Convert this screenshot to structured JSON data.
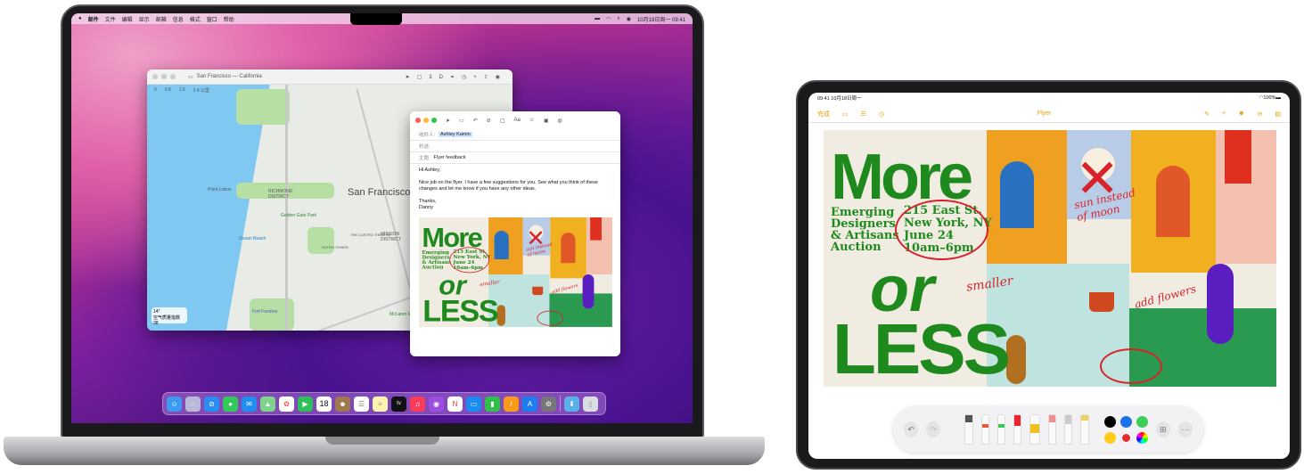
{
  "mac": {
    "menubar": {
      "items": [
        "邮件",
        "文件",
        "编辑",
        "显示",
        "邮箱",
        "信息",
        "格式",
        "窗口",
        "帮助"
      ],
      "clock": "10月18日周一 09:41"
    },
    "maps": {
      "title": "San Francisco — California",
      "scale": [
        "0",
        "0.8",
        "1.6",
        "2.4 公里"
      ],
      "labels": {
        "city": "San Francisco",
        "richmond": "RICHMOND DISTRICT",
        "mission": "MISSION DISTRICT",
        "point_lobos": "Point Lobos",
        "ggpark": "Golden Gate Park",
        "ocean_beach": "Ocean Beach",
        "fort_funston": "Fort Funston",
        "mclaren": "McLaren Park",
        "castro": "THE CASTRO THEATRE",
        "sutro": "SUTRO TOWER"
      },
      "weather": {
        "temp": "14°",
        "aqi": "空气质量指数 38"
      }
    },
    "mail": {
      "to_label": "收件人:",
      "to": "Ashley Kamin",
      "cc_label": "抄送:",
      "subject_label": "主题:",
      "subject": "Flyer feedback",
      "greeting": "Hi Ashley,",
      "body": "Nice job on the flyer. I have a few suggestions for you. See what you think of these changes and let me know if you have any other ideas.",
      "signoff": "Thanks,",
      "name": "Danny"
    },
    "dock": {
      "calendar_day": "18",
      "tv": "tv",
      "items": [
        "Finder",
        "Launchpad",
        "Safari",
        "Messages",
        "Mail",
        "Maps",
        "Photos",
        "FaceTime",
        "Calendar",
        "Contacts",
        "Reminders",
        "Notes",
        "TV",
        "Music",
        "Podcasts",
        "News",
        "Keynote",
        "Numbers",
        "Pages",
        "App Store",
        "System Preferences",
        "Downloads",
        "Trash"
      ]
    }
  },
  "ipad": {
    "status": {
      "time": "09:41 10月18日周一",
      "battery": "100%"
    },
    "toolbar": {
      "done": "完成",
      "title": "Flyer"
    },
    "colors": {
      "black": "#000000",
      "blue": "#1a73e8",
      "green": "#3ccf5a",
      "yellow": "#ffcc1a",
      "red": "#ea2a2f"
    }
  },
  "flyer": {
    "more": "More",
    "info": "Emerging Designers & Artisans Auction",
    "addr1": "215 East St.",
    "addr2": "New York, NY",
    "addr3": "June 24",
    "addr4": "10am–6pm",
    "or": "or",
    "less": "LESS",
    "note_sun": "sun instead of moon",
    "note_smaller": "smaller",
    "note_flowers": "add flowers"
  }
}
